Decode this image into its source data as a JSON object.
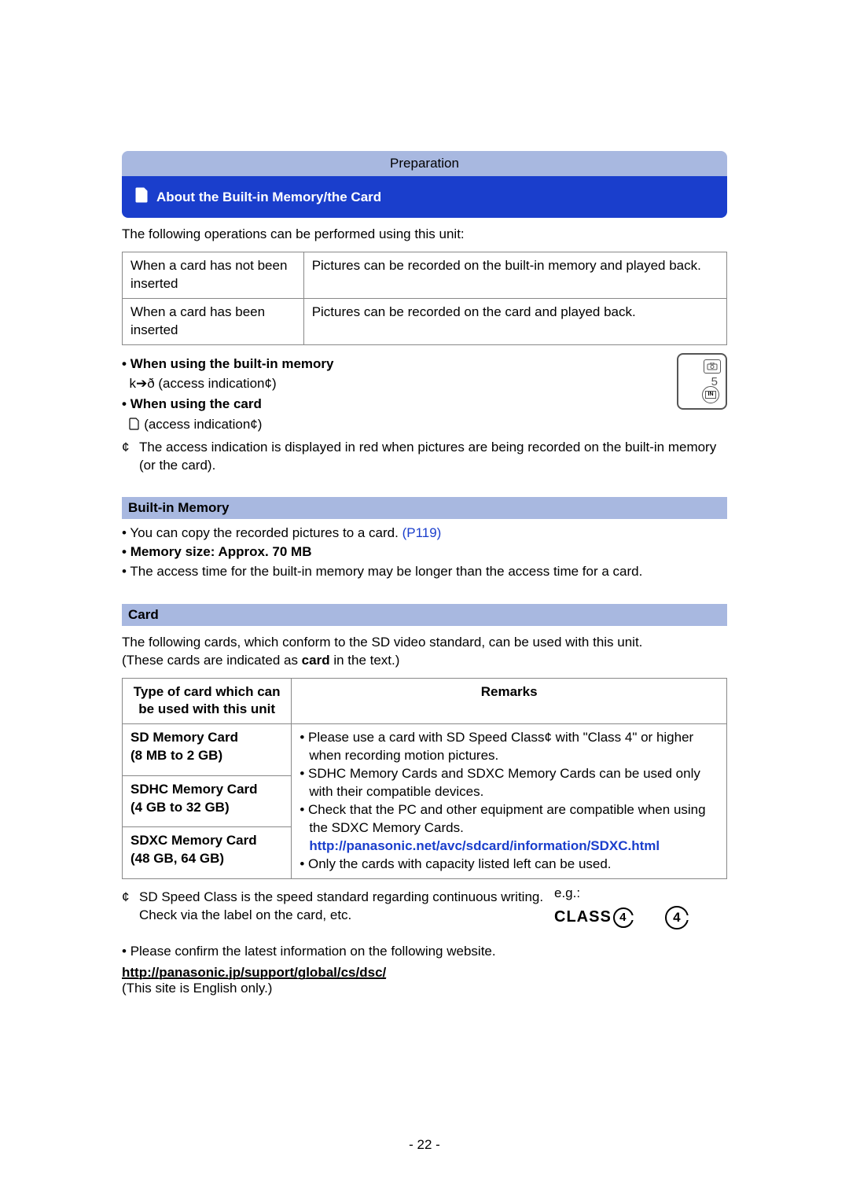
{
  "header": {
    "section_label": "Preparation",
    "page_title": "About the Built-in Memory/the Card"
  },
  "intro": "The following operations can be performed using this unit:",
  "ops_table": {
    "rows": [
      {
        "left": "When a card has not been inserted",
        "right": "Pictures can be recorded on the built-in memory and played back."
      },
      {
        "left": "When a card has been inserted",
        "right": "Pictures can be recorded on the card and played back."
      }
    ]
  },
  "indicators": {
    "card_heading": "When using the built-in memory",
    "card_line": "k➔ð (access indication¢)",
    "builtin_heading": "When using the card",
    "builtin_line": " (access indication¢)",
    "footnote_mark": "¢",
    "footnote_text": "The access indication is displayed in red when pictures are being recorded on the built-in memory (or the card).",
    "lcd_count": "5",
    "lcd_in": "IN"
  },
  "builtin_section": {
    "heading": "Built-in Memory",
    "bullets": [
      {
        "text_pre": "You can copy the recorded pictures to a card. ",
        "link": "(P119)"
      },
      {
        "text_pre": "Memory size: Approx. 70 MB"
      },
      {
        "text_pre": "The access time for the built-in memory may be longer than the access time for a card."
      }
    ]
  },
  "card_section": {
    "heading": "Card",
    "intro": "The following cards, which conform to the SD video standard, can be used with this unit.",
    "intro2_pre": "(These cards are indicated as ",
    "intro2_bold": "card",
    "intro2_post": " in the text.)",
    "table": {
      "col1": "Type of card which can be used with this unit",
      "col2": "Remarks",
      "rows": [
        {
          "name": "SD Memory Card",
          "cap": "(8 MB to 2 GB)"
        },
        {
          "name": "SDHC Memory Card",
          "cap": "(4 GB to 32 GB)"
        },
        {
          "name": "SDXC Memory Card",
          "cap": "(48 GB, 64 GB)"
        }
      ],
      "remarks": [
        "Please use a card with SD Speed Class¢ with \"Class 4\" or higher when recording motion pictures.",
        "SDHC Memory Cards and SDXC Memory Cards can be used only with their compatible devices.",
        "Check that the PC and other equipment are compatible when using the SDXC Memory Cards.",
        "http://panasonic.net/avc/sdcard/information/SDXC.html",
        "Only the cards with capacity listed left can be used."
      ]
    },
    "speed_note_mark": "¢",
    "speed_note": "SD Speed Class is the speed standard regarding continuous writing. Check via the label on the card, etc.",
    "eg_label": "e.g.:",
    "class_text": "CLASS",
    "class_num": "4",
    "confirm_text": "Please confirm the latest information on the following website.",
    "website": "http://panasonic.jp/support/global/cs/dsc/",
    "english_only": "(This site is English only.)"
  },
  "page_number": "- 22 -"
}
